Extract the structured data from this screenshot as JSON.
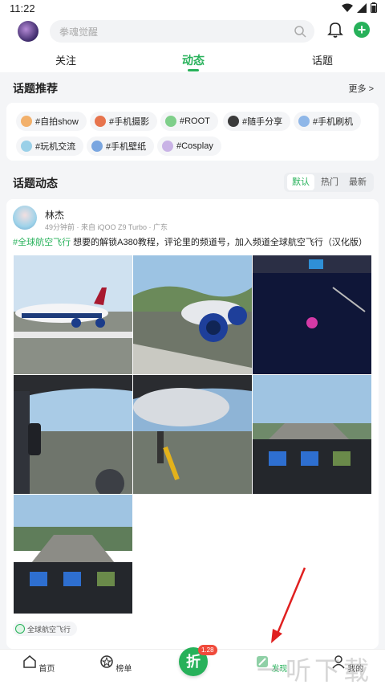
{
  "status": {
    "time": "11:22"
  },
  "search": {
    "placeholder": "拳魂觉醒"
  },
  "tabs": [
    {
      "label": "关注"
    },
    {
      "label": "动态"
    },
    {
      "label": "话题"
    }
  ],
  "topic_recommend": {
    "title": "话题推荐",
    "more": "更多 >",
    "chips": [
      {
        "label": "#自拍show",
        "icon_color": "#f2b06b"
      },
      {
        "label": "#手机摄影",
        "icon_color": "#e7744d"
      },
      {
        "label": "#ROOT",
        "icon_color": "#7fcf8a"
      },
      {
        "label": "#随手分享",
        "icon_color": "#3b3b3b"
      },
      {
        "label": "#手机刷机",
        "icon_color": "#8fb7e8"
      },
      {
        "label": "#玩机交流",
        "icon_color": "#9ad0e8"
      },
      {
        "label": "#手机壁纸",
        "icon_color": "#7aa6e0"
      },
      {
        "label": "#Cosplay",
        "icon_color": "#c9b3e6"
      }
    ]
  },
  "topic_feed": {
    "title": "话题动态",
    "filters": [
      "默认",
      "热门",
      "最新"
    ]
  },
  "post": {
    "author": "林杰",
    "meta": "49分钟前 · 来自 iQOO Z9 Turbo · 广东",
    "tag": "#全球航空飞行",
    "text": " 想要的解锁A380教程，评论里的频道号，加入频道全球航空飞行（汉化版）",
    "topic_tag": "全球航空飞行"
  },
  "bottom_nav": {
    "items": [
      {
        "label": "首页"
      },
      {
        "label": "榜单"
      },
      {
        "label": "折"
      },
      {
        "label": "发现"
      },
      {
        "label": "我的"
      }
    ],
    "badge": "1.28"
  },
  "watermark": "一听下载",
  "colors": {
    "accent": "#27b15a",
    "badge": "#f04a3b",
    "annotation": "#e02020"
  }
}
